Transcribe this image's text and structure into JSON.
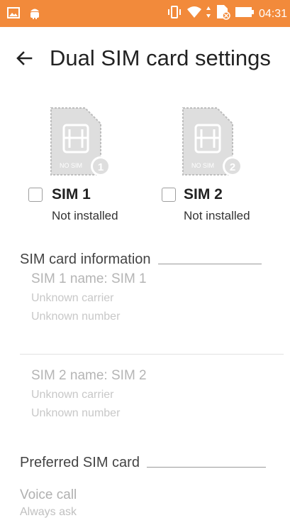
{
  "status_bar": {
    "time": "04:31",
    "left_icons": [
      "gallery-icon",
      "android-icon"
    ],
    "right_icons": [
      "vibrate-icon",
      "wifi-icon",
      "data-arrows-icon",
      "no-sim-icon",
      "battery-icon"
    ],
    "background_color": "#f28a3b"
  },
  "app_bar": {
    "title": "Dual SIM card settings",
    "back_icon": "arrow-back-icon"
  },
  "sims": [
    {
      "label": "SIM 1",
      "status": "Not installed",
      "badge": "1",
      "image_text": "NO SIM",
      "checked": false
    },
    {
      "label": "SIM 2",
      "status": "Not installed",
      "badge": "2",
      "image_text": "NO SIM",
      "checked": false
    }
  ],
  "sim_info": {
    "header": "SIM card information",
    "items": [
      {
        "name": "SIM 1 name: SIM 1",
        "carrier": "Unknown carrier",
        "number": "Unknown number"
      },
      {
        "name": "SIM 2 name: SIM 2",
        "carrier": "Unknown carrier",
        "number": "Unknown number"
      }
    ]
  },
  "preferred": {
    "header": "Preferred SIM card",
    "voice_call": {
      "title": "Voice call",
      "value": "Always ask"
    }
  }
}
